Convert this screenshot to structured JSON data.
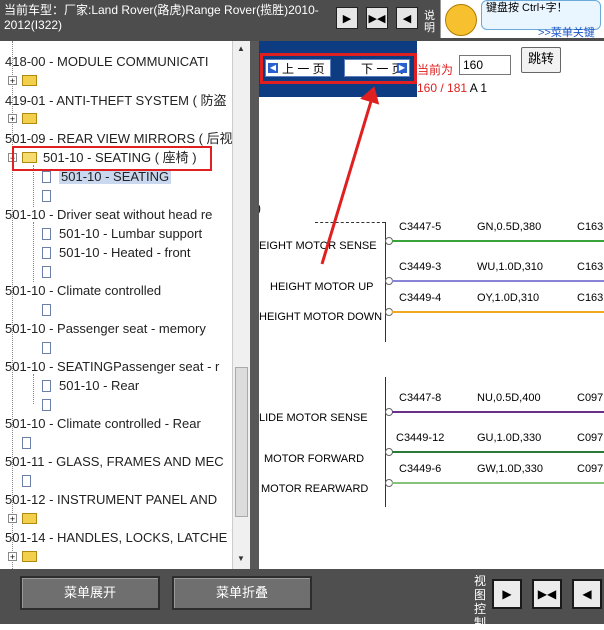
{
  "header": {
    "vehicle_text": "当前车型：厂家:Land Rover(路虎)Range Rover(揽胜)2010-2012(I322)",
    "buttons": [
      "▶",
      "▶◀",
      "◀"
    ],
    "side_text": "说明",
    "notice_text": "键盘按 Ctrl+字！",
    "notice_link": ">>菜单关键"
  },
  "tree": {
    "items": [
      {
        "text": "418-00 - MODULE COMMUNICATI"
      },
      {
        "text": "419-01 - ANTI-THEFT SYSTEM ( 防盗"
      },
      {
        "text": "501-09 - REAR VIEW MIRRORS ( 后视"
      },
      {
        "text": "501-10 - SEATING ( 座椅 )"
      },
      {
        "text": "501-10 - SEATING"
      },
      {
        "text": "501-10 - Driver seat without head re"
      },
      {
        "text": "501-10 - Lumbar support"
      },
      {
        "text": "501-10 - Heated - front"
      },
      {
        "text": "501-10 - Climate controlled"
      },
      {
        "text": "501-10 - Passenger seat - memory"
      },
      {
        "text": "501-10 - SEATINGPassenger seat - r"
      },
      {
        "text": "501-10 - Rear"
      },
      {
        "text": "501-10 - Climate controlled - Rear"
      },
      {
        "text": "501-11 - GLASS, FRAMES AND MEC"
      },
      {
        "text": "501-12 - INSTRUMENT PANEL AND"
      },
      {
        "text": "501-14 - HANDLES, LOCKS, LATCHE"
      }
    ]
  },
  "nav": {
    "prev_label": "上 一 页",
    "next_label": "下 一 页",
    "current_label": "当前为",
    "page_value": "160",
    "jump_label": "跳转",
    "page_current": "160",
    "page_sep": " / ",
    "page_total": "181",
    "sheet": " A 1"
  },
  "diagram": {
    "labels": [
      "EIGHT MOTOR SENSE",
      "HEIGHT MOTOR UP",
      "HEIGHT MOTOR DOWN",
      "LIDE MOTOR SENSE",
      "MOTOR FORWARD",
      "MOTOR REARWARD"
    ],
    "wires": [
      {
        "conn": "C3447-5",
        "spec": "GN,0.5D,380",
        "end": "C163",
        "color": "#3aa23a"
      },
      {
        "conn": "C3449-3",
        "spec": "WU,1.0D,310",
        "end": "C163",
        "color": "#8a84d6"
      },
      {
        "conn": "C3449-4",
        "spec": "OY,1.0D,310",
        "end": "C163",
        "color": "#f0a81e"
      },
      {
        "conn": "C3447-8",
        "spec": "NU,0.5D,400",
        "end": "C097",
        "color": "#6a2f8a"
      },
      {
        "conn": "C3449-12",
        "spec": "GU,1.0D,330",
        "end": "C097",
        "color": "#2a7a3a"
      },
      {
        "conn": "C3449-6",
        "spec": "GW,1.0D,330",
        "end": "C097",
        "color": "#86c27a"
      }
    ],
    "paren": ")"
  },
  "bottom": {
    "expand_label": "菜单展开",
    "collapse_label": "菜单折叠",
    "view_label": "视图控制",
    "view_buttons": [
      "▶",
      "▶◀",
      "◀"
    ]
  }
}
